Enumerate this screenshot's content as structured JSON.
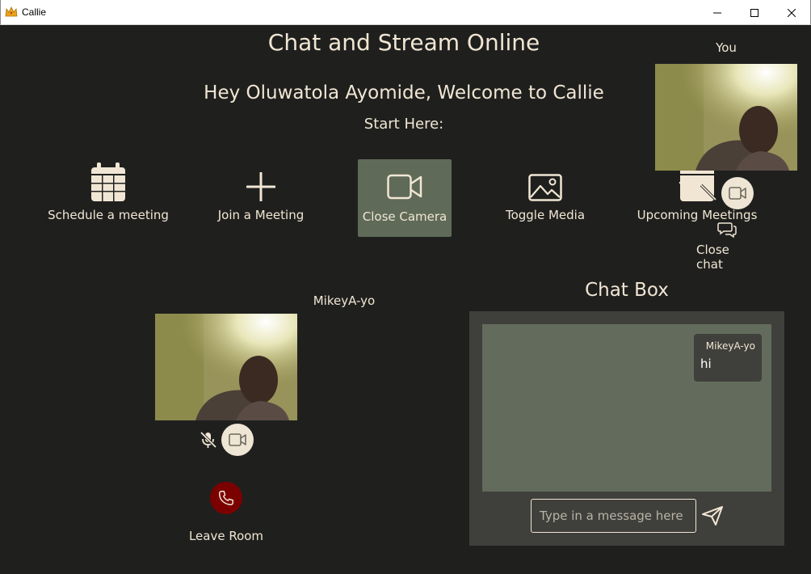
{
  "window": {
    "title": "Callie",
    "app_icon": "crown-icon"
  },
  "header": {
    "title": "Chat and Stream Online",
    "welcome": "Hey Oluwatola Ayomide, Welcome to Callie",
    "start_here": "Start Here:"
  },
  "actions": [
    {
      "label": "Schedule a meeting",
      "icon": "calendar-icon"
    },
    {
      "label": "Join a Meeting",
      "icon": "plus-icon"
    },
    {
      "label": "Close Camera",
      "icon": "video-camera-icon",
      "active": true
    },
    {
      "label": "Toggle Media",
      "icon": "image-icon"
    },
    {
      "label": "Upcoming Meetings",
      "icon": "calendar-icon"
    }
  ],
  "self_view": {
    "label": "You",
    "mic": "mic-off-icon",
    "camera": "video-camera-icon"
  },
  "close_chat": {
    "label": "Close chat",
    "icon": "chat-bubbles-icon"
  },
  "remote": {
    "name": "MikeyA-yo",
    "mic": "mic-off-icon",
    "camera": "video-camera-icon"
  },
  "leave": {
    "label": "Leave Room",
    "icon": "phone-icon",
    "color": "#7b0000"
  },
  "chat": {
    "title": "Chat Box",
    "messages": [
      {
        "sender": "MikeyA-yo",
        "text": "hi"
      }
    ],
    "input": {
      "value": "",
      "placeholder": "Type in a message here"
    },
    "send_icon": "send-icon"
  },
  "colors": {
    "background": "#1f201e",
    "text": "#f1e6d4",
    "accent": "#5f6a58",
    "panel": "#3f403b",
    "message_area": "#636c5c"
  }
}
